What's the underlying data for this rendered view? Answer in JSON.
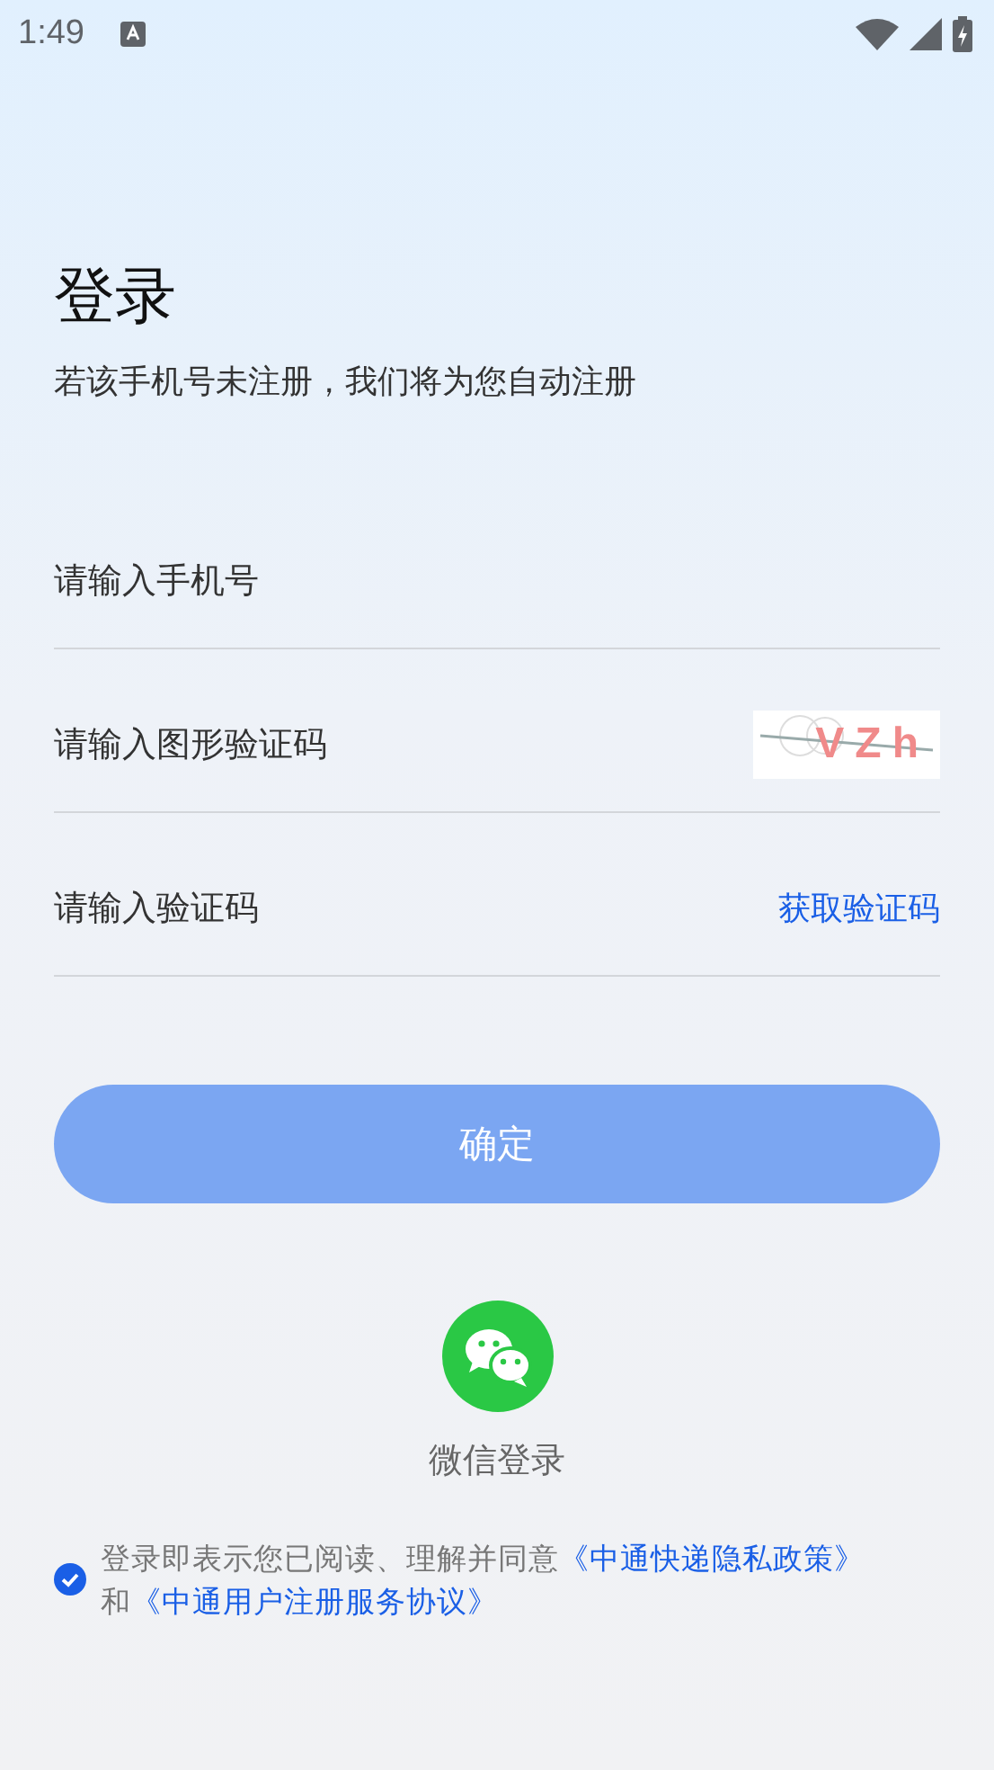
{
  "status_bar": {
    "time": "1:49"
  },
  "title": "登录",
  "subtitle": "若该手机号未注册，我们将为您自动注册",
  "fields": [
    {
      "kind": "plain",
      "placeholder": "请输入手机号"
    },
    {
      "kind": "captcha",
      "placeholder": "请输入图形验证码",
      "captcha_text": "VZh"
    },
    {
      "kind": "code",
      "placeholder": "请输入验证码",
      "action": "获取验证码"
    }
  ],
  "submit": {
    "label": "确定",
    "disabled": true
  },
  "wechat": {
    "label": "微信登录"
  },
  "agreement": {
    "checked": true,
    "text": "登录即表示您已阅读、理解并同意",
    "link_1": "《中通快递隐私政策》",
    "joiner": "和",
    "link_2": "《中通用户注册服务协议》"
  }
}
